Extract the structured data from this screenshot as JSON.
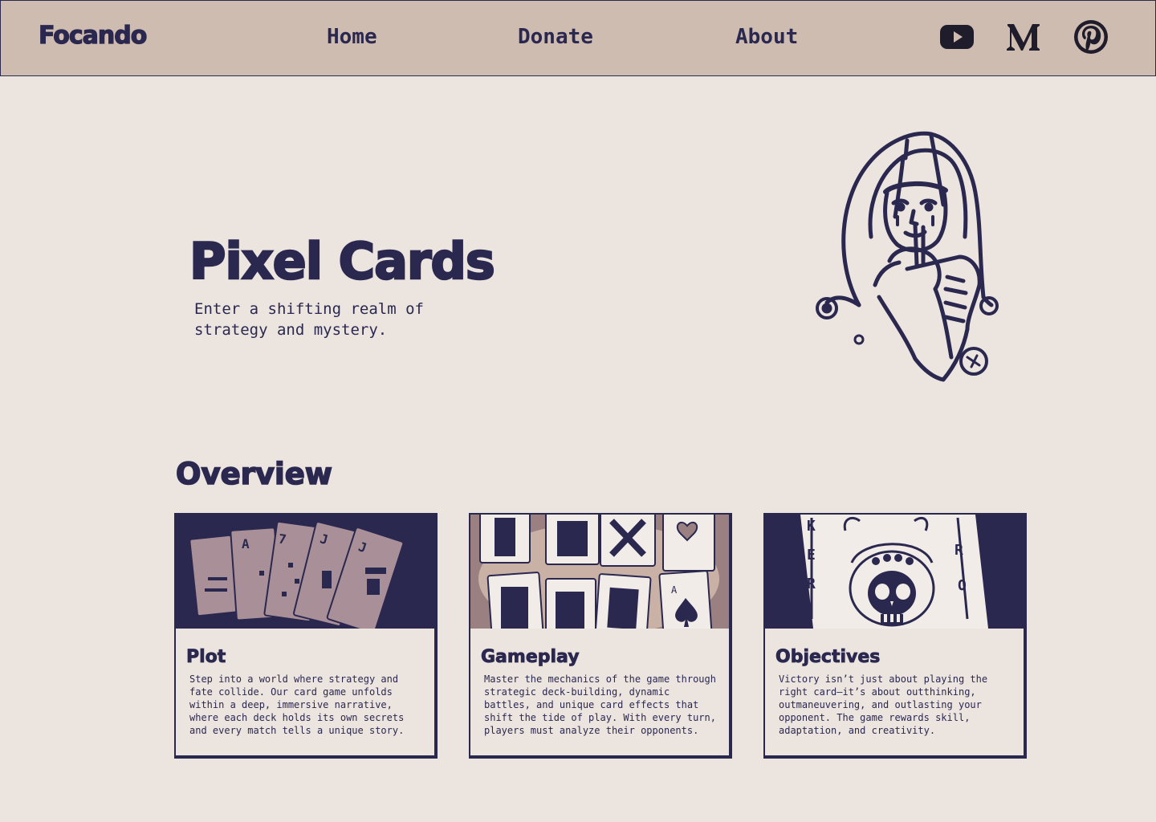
{
  "header": {
    "brand": "Focando",
    "nav": [
      {
        "label": "Home"
      },
      {
        "label": "Donate"
      },
      {
        "label": "About"
      }
    ],
    "social": [
      {
        "icon": "youtube-icon"
      },
      {
        "icon": "medium-icon"
      },
      {
        "icon": "pinterest-icon"
      }
    ]
  },
  "hero": {
    "title": "Pixel Cards",
    "subtitle": "Enter a shifting realm of strategy and mystery.",
    "illustration": "jester-illustration"
  },
  "overview": {
    "title": "Overview",
    "cards": [
      {
        "title": "Plot",
        "text": "Step into a world where strategy and fate collide. Our card game unfolds within a deep, immersive narrative, where each deck holds its own secrets and every match tells a unique story."
      },
      {
        "title": "Gameplay",
        "text": "Master the mechanics of the game through strategic deck-building, dynamic battles, and unique card effects that shift the tide of play. With every turn, players must analyze their opponents."
      },
      {
        "title": "Objectives",
        "text": "Victory isn’t just about playing the right card—it’s about outthinking, outmaneuvering, and outlasting your opponent. The game rewards skill, adaptation, and creativity."
      }
    ]
  },
  "colors": {
    "page_bg": "#ece4df",
    "header_bg": "#cfbcb1",
    "ink": "#2b2850",
    "card_mauve": "#a98f97",
    "card_tan": "#c9b1a6"
  }
}
